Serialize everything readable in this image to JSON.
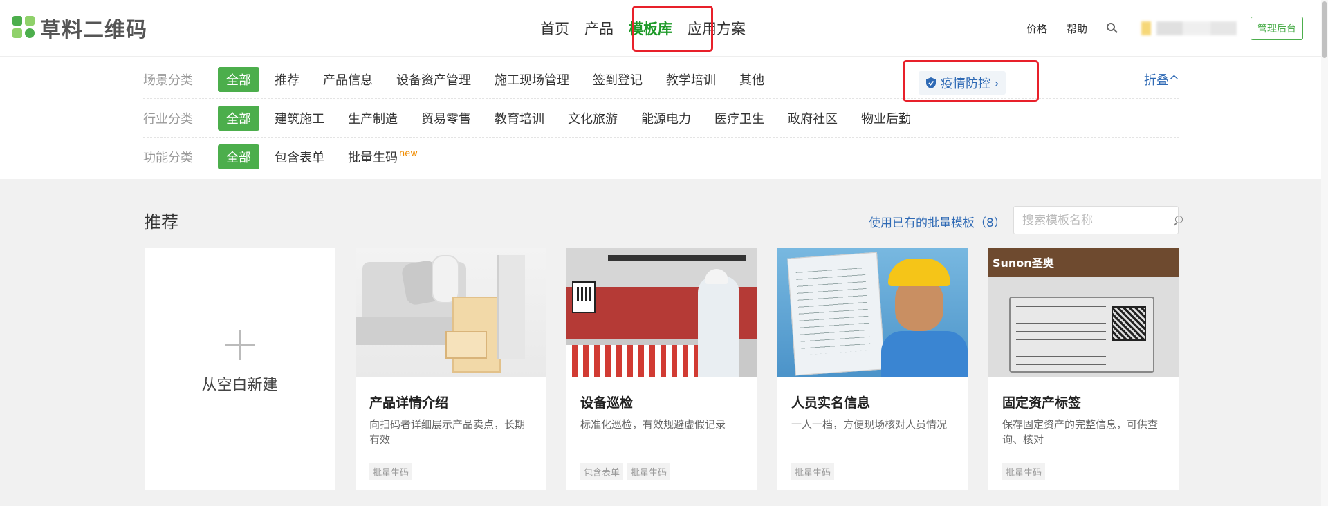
{
  "header": {
    "logo_text": "草料二维码",
    "nav": [
      {
        "label": "首页"
      },
      {
        "label": "产品"
      },
      {
        "label": "模板库",
        "active": true
      },
      {
        "label": "应用方案"
      }
    ],
    "right_links": [
      {
        "label": "价格"
      },
      {
        "label": "帮助"
      }
    ],
    "admin_label": "管理后台"
  },
  "filters": {
    "rows": [
      {
        "label": "场景分类",
        "items": [
          "全部",
          "推荐",
          "产品信息",
          "设备资产管理",
          "施工现场管理",
          "签到登记",
          "教学培训",
          "其他"
        ],
        "selected": "全部"
      },
      {
        "label": "行业分类",
        "items": [
          "全部",
          "建筑施工",
          "生产制造",
          "贸易零售",
          "教育培训",
          "文化旅游",
          "能源电力",
          "医疗卫生",
          "政府社区",
          "物业后勤"
        ],
        "selected": "全部"
      },
      {
        "label": "功能分类",
        "items": [
          "全部",
          "包含表单",
          "批量生码"
        ],
        "selected": "全部",
        "new_badge": "new"
      }
    ],
    "epidemic_label": "疫情防控",
    "epidemic_chevron": "›",
    "fold_label": "折叠^"
  },
  "main": {
    "section_title": "推荐",
    "batch_link": "使用已有的批量模板（8）",
    "search_placeholder": "搜索模板名称",
    "blank_card_label": "从空白新建",
    "cards": [
      {
        "title": "产品详情介绍",
        "desc": "向扫码者详细展示产品卖点，长期有效",
        "tags": [
          "批量生码"
        ]
      },
      {
        "title": "设备巡检",
        "desc": "标准化巡检，有效规避虚假记录",
        "tags": [
          "包含表单",
          "批量生码"
        ]
      },
      {
        "title": "人员实名信息",
        "desc": "一人一档，方便现场核对人员情况",
        "tags": [
          "批量生码"
        ]
      },
      {
        "title": "固定资产标签",
        "desc": "保存固定资产的完整信息，可供查询、核对",
        "tags": [
          "批量生码"
        ]
      }
    ],
    "asset_image_brand": "Sunon圣奥"
  },
  "colors": {
    "brand_green": "#4cae4c",
    "active_nav": "#1e9a29",
    "link_blue": "#2f6ab5",
    "highlight_red": "#e8202a"
  }
}
